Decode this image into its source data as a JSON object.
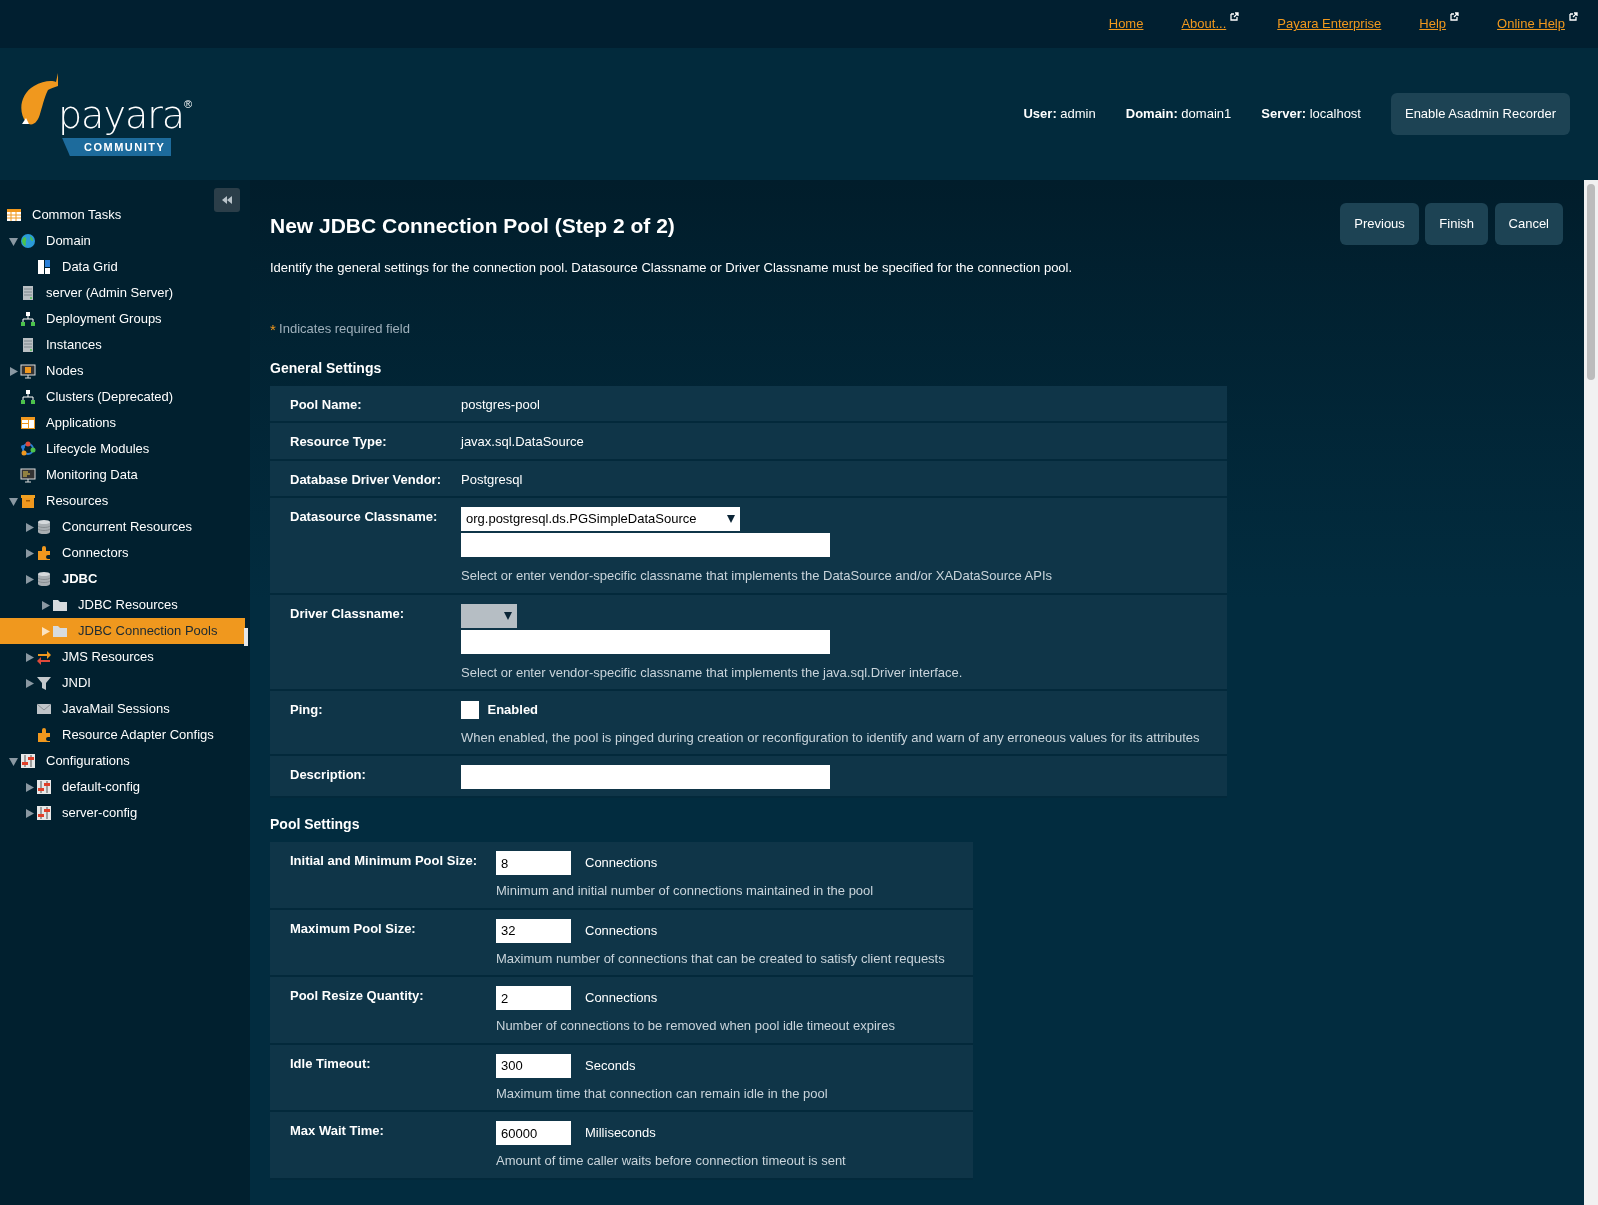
{
  "top_links": [
    {
      "label": "Home",
      "external": false
    },
    {
      "label": "About...",
      "external": true
    },
    {
      "label": "Payara Enterprise",
      "external": false
    },
    {
      "label": "Help",
      "external": true
    },
    {
      "label": "Online Help",
      "external": true
    }
  ],
  "logo": {
    "wordmark": "payara",
    "mark": "®",
    "edition": "COMMUNITY"
  },
  "header_info": [
    "**User:** admin",
    "**Domain:** domain1",
    "**Server:** localhost"
  ],
  "header_button": "Enable Asadmin Recorder",
  "sidebar": {
    "common_tasks": {
      "label": "Common Tasks",
      "selected": false
    },
    "items": [
      {
        "label": "Domain",
        "selected": false,
        "bold": false,
        "expanded": true,
        "children": [
          {
            "label": "Data Grid",
            "selected": false,
            "bold": false
          }
        ]
      },
      {
        "label": "server (Admin Server)",
        "selected": false,
        "bold": false
      },
      {
        "label": "Deployment Groups",
        "selected": false,
        "bold": false
      },
      {
        "label": "Instances",
        "selected": false,
        "bold": false
      },
      {
        "label": "Nodes",
        "selected": false,
        "bold": false,
        "expanded": false
      },
      {
        "label": "Clusters (Deprecated)",
        "selected": false,
        "bold": false
      },
      {
        "label": "Applications",
        "selected": false,
        "bold": false
      },
      {
        "label": "Lifecycle Modules",
        "selected": false,
        "bold": false
      },
      {
        "label": "Monitoring Data",
        "selected": false,
        "bold": false
      },
      {
        "label": "Resources",
        "selected": false,
        "bold": false,
        "expanded": true,
        "children": [
          {
            "label": "Concurrent Resources",
            "selected": false,
            "bold": false,
            "expanded": false
          },
          {
            "label": "Connectors",
            "selected": false,
            "bold": false,
            "expanded": false
          },
          {
            "label": "JDBC",
            "selected": false,
            "bold": true,
            "expanded": false,
            "children": [
              {
                "label": "JDBC Resources",
                "selected": false,
                "bold": false,
                "expanded": false
              },
              {
                "label": "JDBC Connection Pools",
                "selected": true,
                "bold": false,
                "expanded": false
              }
            ]
          },
          {
            "label": "JMS Resources",
            "selected": false,
            "bold": false,
            "expanded": false
          },
          {
            "label": "JNDI",
            "selected": false,
            "bold": false,
            "expanded": false
          },
          {
            "label": "JavaMail Sessions",
            "selected": false,
            "bold": false
          },
          {
            "label": "Resource Adapter Configs",
            "selected": false,
            "bold": false
          }
        ]
      },
      {
        "label": "Configurations",
        "selected": false,
        "bold": false,
        "expanded": true,
        "children": [
          {
            "label": "default-config",
            "selected": false,
            "bold": false,
            "expanded": false
          },
          {
            "label": "server-config",
            "selected": false,
            "bold": false,
            "expanded": false
          }
        ]
      }
    ]
  },
  "page": {
    "title": "New JDBC Connection Pool (Step 2 of 2)",
    "buttons": [
      "Previous",
      "Finish",
      "Cancel"
    ],
    "description": "Identify the general settings for the connection pool. Datasource Classname or Driver Classname must be specified for the connection pool.",
    "required_mark": "*",
    "required_note": "Indicates required field"
  },
  "general_settings": {
    "heading": "General Settings",
    "rows": [
      {
        "kind": "text",
        "label": "Pool Name:",
        "value": "postgres-pool"
      },
      {
        "kind": "text",
        "label": "Resource Type:",
        "value": "javax.sql.DataSource"
      },
      {
        "kind": "text",
        "label": "Database Driver Vendor:",
        "value": "Postgresql"
      },
      {
        "kind": "combo",
        "label": "Datasource Classname:",
        "selection": "org.postgresql.ds.PGSimpleDataSource",
        "help": "Select or enter vendor-specific classname that implements the DataSource and/or XADataSource APIs"
      },
      {
        "kind": "combo",
        "label": "Driver Classname:",
        "help": "Select or enter vendor-specific classname that implements the java.sql.Driver interface."
      },
      {
        "kind": "checkbox",
        "label": "Ping:",
        "checked": false,
        "option": "Enabled",
        "help": "When enabled, the pool is pinged during creation or reconfiguration to identify and warn of any erroneous values for its attributes"
      },
      {
        "kind": "input",
        "label": "Description:"
      }
    ]
  },
  "pool_settings": {
    "heading": "Pool Settings",
    "rows": [
      {
        "label": "Initial and Minimum Pool Size:",
        "value": "8",
        "unit": "Connections",
        "help": "Minimum and initial number of connections maintained in the pool"
      },
      {
        "label": "Maximum Pool Size:",
        "value": "32",
        "unit": "Connections",
        "help": "Maximum number of connections that can be created to satisfy client requests"
      },
      {
        "label": "Pool Resize Quantity:",
        "value": "2",
        "unit": "Connections",
        "help": "Number of connections to be removed when pool idle timeout expires"
      },
      {
        "label": "Idle Timeout:",
        "value": "300",
        "unit": "Seconds",
        "help": "Maximum time that connection can remain idle in the pool"
      },
      {
        "label": "Max Wait Time:",
        "value": "60000",
        "unit": "Milliseconds",
        "help": "Amount of time caller waits before connection timeout is sent"
      }
    ]
  }
}
